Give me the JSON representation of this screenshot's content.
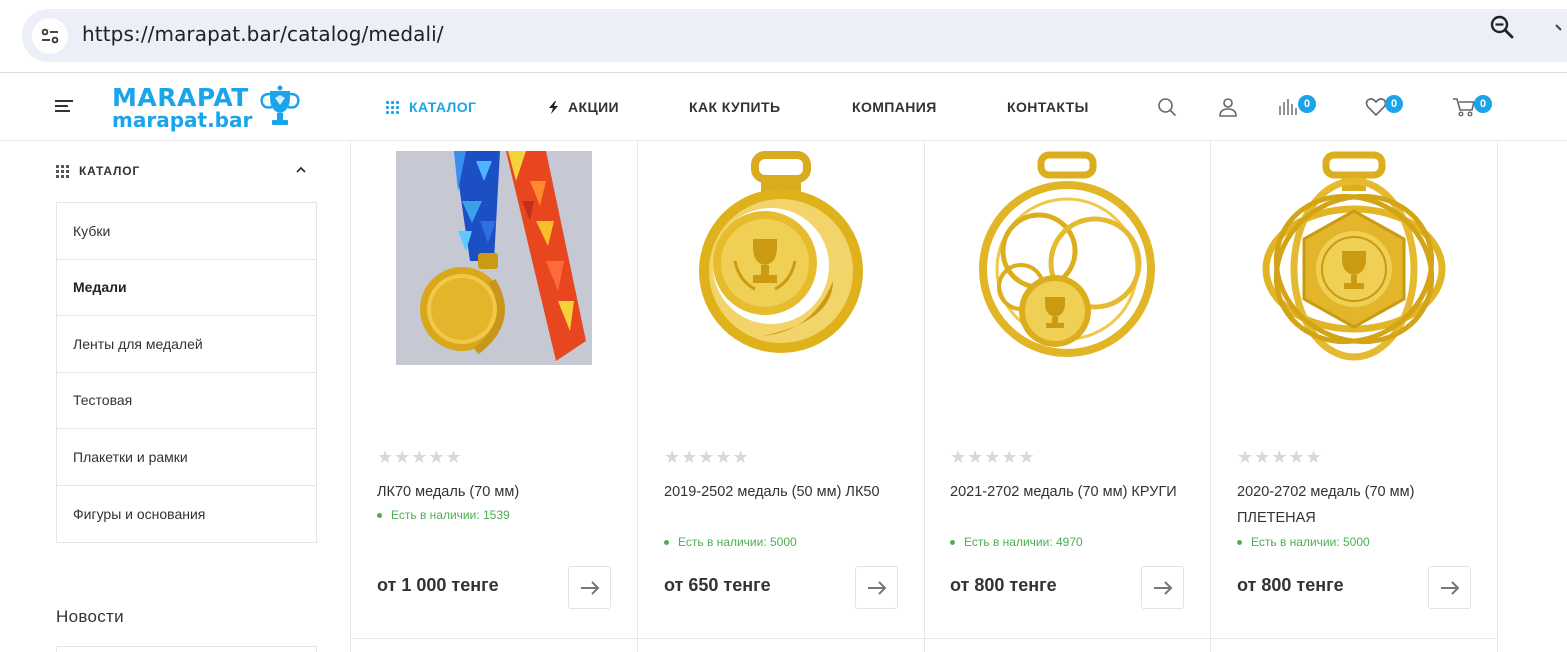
{
  "browser": {
    "url": "https://marapat.bar/catalog/medali/"
  },
  "header": {
    "logo_top": "MARAPAT",
    "logo_bottom": "marapat.bar",
    "nav": [
      {
        "label": "КАТАЛОГ"
      },
      {
        "label": "АКЦИИ"
      },
      {
        "label": "КАК КУПИТЬ"
      },
      {
        "label": "КОМПАНИЯ"
      },
      {
        "label": "КОНТАКТЫ"
      }
    ],
    "compare_count": "0",
    "favorites_count": "0",
    "cart_count": "0"
  },
  "sidebar": {
    "title": "КАТАЛОГ",
    "items": [
      {
        "label": "Кубки"
      },
      {
        "label": "Медали"
      },
      {
        "label": "Ленты для медалей"
      },
      {
        "label": "Тестовая"
      },
      {
        "label": "Плакетки и рамки"
      },
      {
        "label": "Фигуры и основания"
      }
    ],
    "news_title": "Новости"
  },
  "products": [
    {
      "stars": "★★★★★",
      "name": "ЛК70 медаль (70 мм)",
      "stock": "Есть в наличии: 1539",
      "price": "от 1 000 тенге"
    },
    {
      "stars": "★★★★★",
      "name": "2019-2502 медаль (50 мм) ЛК50",
      "stock": "Есть в наличии: 5000",
      "price": "от 650 тенге"
    },
    {
      "stars": "★★★★★",
      "name": "2021-2702 медаль (70 мм) КРУГИ",
      "stock": "Есть в наличии: 4970",
      "price": "от 800 тенге"
    },
    {
      "stars": "★★★★★",
      "name": "2020-2702 медаль (70 мм) ПЛЕТЕНАЯ",
      "stock": "Есть в наличии: 5000",
      "price": "от 800 тенге"
    }
  ],
  "colors": {
    "accent": "#1aa4ea",
    "stock_green": "#4caf50",
    "gold": "#e0b21a"
  }
}
